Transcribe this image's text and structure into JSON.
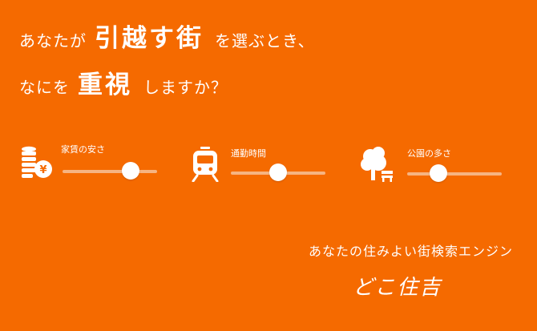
{
  "headline": {
    "line1": {
      "pre": "あなたが",
      "emphasis": "引越す街",
      "post": "を選ぶとき、"
    },
    "line2": {
      "pre": "なにを",
      "emphasis": "重視",
      "post": "しますか？"
    }
  },
  "factors": [
    {
      "label": "家賃の安さ",
      "icon": "coins-yen-icon",
      "value": 0.72
    },
    {
      "label": "通勤時間",
      "icon": "train-icon",
      "value": 0.5
    },
    {
      "label": "公園の多さ",
      "icon": "park-tree-icon",
      "value": 0.33
    }
  ],
  "footer": {
    "tagline": "あなたの住みよい街検索エンジン",
    "brand": "どこ住吉"
  },
  "colors": {
    "background": "#f56a00",
    "foreground": "#ffffff",
    "track": "#f6b482"
  }
}
